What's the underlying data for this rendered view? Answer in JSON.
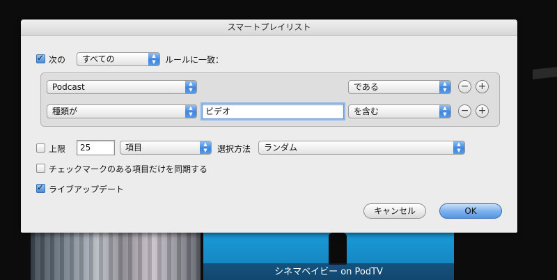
{
  "dialog": {
    "title": "スマートプレイリスト",
    "match": {
      "checked": true,
      "prefix": "次の",
      "selected": "すべての",
      "suffix": "ルールに一致："
    },
    "rules": [
      {
        "field": "Podcast",
        "value": "",
        "operator": "である"
      },
      {
        "field": "種類が",
        "value": "ビデオ",
        "operator": "を含む"
      }
    ],
    "limit": {
      "checked": false,
      "label": "上限",
      "value": "25",
      "unit": "項目",
      "method_label": "選択方法",
      "method": "ランダム"
    },
    "checked_only": {
      "checked": false,
      "label": "チェックマークのある項目だけを同期する"
    },
    "live_update": {
      "checked": true,
      "label": "ライブアップデート"
    },
    "buttons": {
      "cancel": "キャンセル",
      "ok": "OK"
    },
    "icons": {
      "remove": "minus-icon",
      "add": "plus-icon",
      "popup": "updown-arrows-icon"
    }
  },
  "background": {
    "caption": "シネマベイビー on PodTV"
  }
}
